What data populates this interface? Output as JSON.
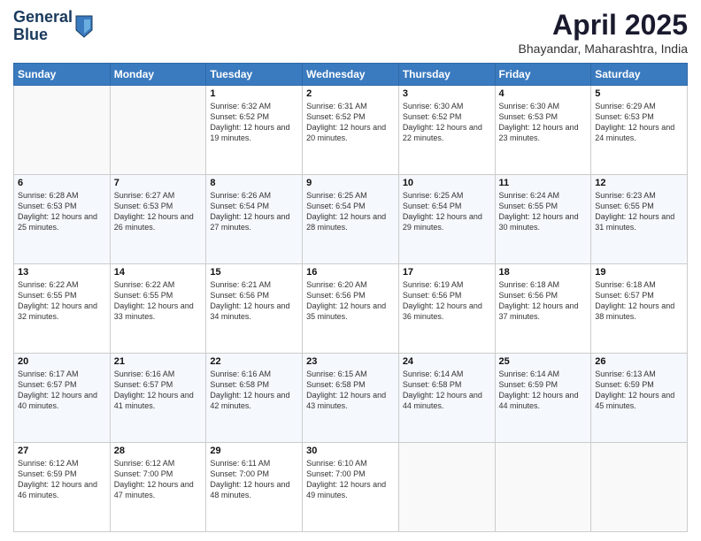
{
  "header": {
    "logo_line1": "General",
    "logo_line2": "Blue",
    "title": "April 2025",
    "subtitle": "Bhayandar, Maharashtra, India"
  },
  "weekdays": [
    "Sunday",
    "Monday",
    "Tuesday",
    "Wednesday",
    "Thursday",
    "Friday",
    "Saturday"
  ],
  "weeks": [
    [
      {
        "day": "",
        "sunrise": "",
        "sunset": "",
        "daylight": ""
      },
      {
        "day": "",
        "sunrise": "",
        "sunset": "",
        "daylight": ""
      },
      {
        "day": "1",
        "sunrise": "Sunrise: 6:32 AM",
        "sunset": "Sunset: 6:52 PM",
        "daylight": "Daylight: 12 hours and 19 minutes."
      },
      {
        "day": "2",
        "sunrise": "Sunrise: 6:31 AM",
        "sunset": "Sunset: 6:52 PM",
        "daylight": "Daylight: 12 hours and 20 minutes."
      },
      {
        "day": "3",
        "sunrise": "Sunrise: 6:30 AM",
        "sunset": "Sunset: 6:52 PM",
        "daylight": "Daylight: 12 hours and 22 minutes."
      },
      {
        "day": "4",
        "sunrise": "Sunrise: 6:30 AM",
        "sunset": "Sunset: 6:53 PM",
        "daylight": "Daylight: 12 hours and 23 minutes."
      },
      {
        "day": "5",
        "sunrise": "Sunrise: 6:29 AM",
        "sunset": "Sunset: 6:53 PM",
        "daylight": "Daylight: 12 hours and 24 minutes."
      }
    ],
    [
      {
        "day": "6",
        "sunrise": "Sunrise: 6:28 AM",
        "sunset": "Sunset: 6:53 PM",
        "daylight": "Daylight: 12 hours and 25 minutes."
      },
      {
        "day": "7",
        "sunrise": "Sunrise: 6:27 AM",
        "sunset": "Sunset: 6:53 PM",
        "daylight": "Daylight: 12 hours and 26 minutes."
      },
      {
        "day": "8",
        "sunrise": "Sunrise: 6:26 AM",
        "sunset": "Sunset: 6:54 PM",
        "daylight": "Daylight: 12 hours and 27 minutes."
      },
      {
        "day": "9",
        "sunrise": "Sunrise: 6:25 AM",
        "sunset": "Sunset: 6:54 PM",
        "daylight": "Daylight: 12 hours and 28 minutes."
      },
      {
        "day": "10",
        "sunrise": "Sunrise: 6:25 AM",
        "sunset": "Sunset: 6:54 PM",
        "daylight": "Daylight: 12 hours and 29 minutes."
      },
      {
        "day": "11",
        "sunrise": "Sunrise: 6:24 AM",
        "sunset": "Sunset: 6:55 PM",
        "daylight": "Daylight: 12 hours and 30 minutes."
      },
      {
        "day": "12",
        "sunrise": "Sunrise: 6:23 AM",
        "sunset": "Sunset: 6:55 PM",
        "daylight": "Daylight: 12 hours and 31 minutes."
      }
    ],
    [
      {
        "day": "13",
        "sunrise": "Sunrise: 6:22 AM",
        "sunset": "Sunset: 6:55 PM",
        "daylight": "Daylight: 12 hours and 32 minutes."
      },
      {
        "day": "14",
        "sunrise": "Sunrise: 6:22 AM",
        "sunset": "Sunset: 6:55 PM",
        "daylight": "Daylight: 12 hours and 33 minutes."
      },
      {
        "day": "15",
        "sunrise": "Sunrise: 6:21 AM",
        "sunset": "Sunset: 6:56 PM",
        "daylight": "Daylight: 12 hours and 34 minutes."
      },
      {
        "day": "16",
        "sunrise": "Sunrise: 6:20 AM",
        "sunset": "Sunset: 6:56 PM",
        "daylight": "Daylight: 12 hours and 35 minutes."
      },
      {
        "day": "17",
        "sunrise": "Sunrise: 6:19 AM",
        "sunset": "Sunset: 6:56 PM",
        "daylight": "Daylight: 12 hours and 36 minutes."
      },
      {
        "day": "18",
        "sunrise": "Sunrise: 6:18 AM",
        "sunset": "Sunset: 6:56 PM",
        "daylight": "Daylight: 12 hours and 37 minutes."
      },
      {
        "day": "19",
        "sunrise": "Sunrise: 6:18 AM",
        "sunset": "Sunset: 6:57 PM",
        "daylight": "Daylight: 12 hours and 38 minutes."
      }
    ],
    [
      {
        "day": "20",
        "sunrise": "Sunrise: 6:17 AM",
        "sunset": "Sunset: 6:57 PM",
        "daylight": "Daylight: 12 hours and 40 minutes."
      },
      {
        "day": "21",
        "sunrise": "Sunrise: 6:16 AM",
        "sunset": "Sunset: 6:57 PM",
        "daylight": "Daylight: 12 hours and 41 minutes."
      },
      {
        "day": "22",
        "sunrise": "Sunrise: 6:16 AM",
        "sunset": "Sunset: 6:58 PM",
        "daylight": "Daylight: 12 hours and 42 minutes."
      },
      {
        "day": "23",
        "sunrise": "Sunrise: 6:15 AM",
        "sunset": "Sunset: 6:58 PM",
        "daylight": "Daylight: 12 hours and 43 minutes."
      },
      {
        "day": "24",
        "sunrise": "Sunrise: 6:14 AM",
        "sunset": "Sunset: 6:58 PM",
        "daylight": "Daylight: 12 hours and 44 minutes."
      },
      {
        "day": "25",
        "sunrise": "Sunrise: 6:14 AM",
        "sunset": "Sunset: 6:59 PM",
        "daylight": "Daylight: 12 hours and 44 minutes."
      },
      {
        "day": "26",
        "sunrise": "Sunrise: 6:13 AM",
        "sunset": "Sunset: 6:59 PM",
        "daylight": "Daylight: 12 hours and 45 minutes."
      }
    ],
    [
      {
        "day": "27",
        "sunrise": "Sunrise: 6:12 AM",
        "sunset": "Sunset: 6:59 PM",
        "daylight": "Daylight: 12 hours and 46 minutes."
      },
      {
        "day": "28",
        "sunrise": "Sunrise: 6:12 AM",
        "sunset": "Sunset: 7:00 PM",
        "daylight": "Daylight: 12 hours and 47 minutes."
      },
      {
        "day": "29",
        "sunrise": "Sunrise: 6:11 AM",
        "sunset": "Sunset: 7:00 PM",
        "daylight": "Daylight: 12 hours and 48 minutes."
      },
      {
        "day": "30",
        "sunrise": "Sunrise: 6:10 AM",
        "sunset": "Sunset: 7:00 PM",
        "daylight": "Daylight: 12 hours and 49 minutes."
      },
      {
        "day": "",
        "sunrise": "",
        "sunset": "",
        "daylight": ""
      },
      {
        "day": "",
        "sunrise": "",
        "sunset": "",
        "daylight": ""
      },
      {
        "day": "",
        "sunrise": "",
        "sunset": "",
        "daylight": ""
      }
    ]
  ]
}
